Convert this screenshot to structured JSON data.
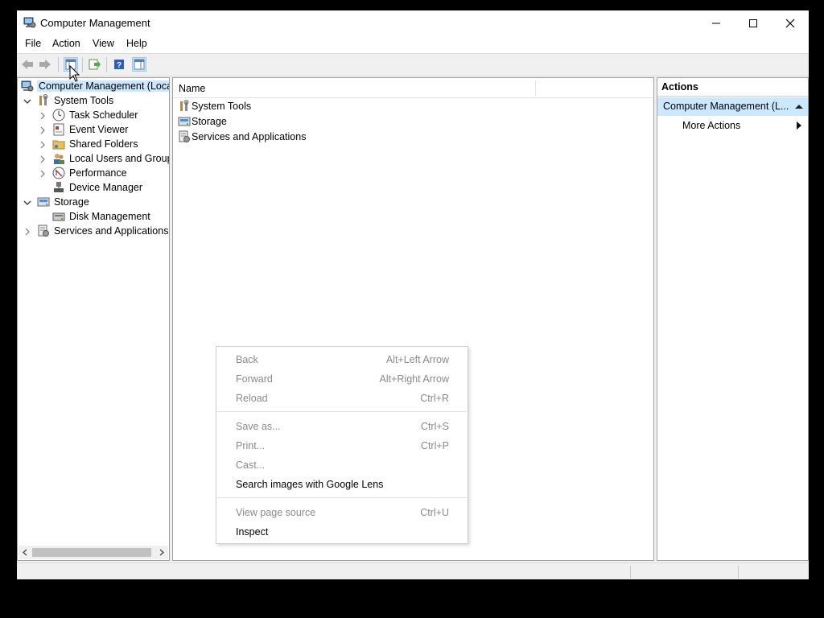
{
  "window": {
    "title": "Computer Management",
    "controls": [
      "minimize",
      "maximize",
      "close"
    ]
  },
  "menubar": [
    "File",
    "Action",
    "View",
    "Help"
  ],
  "toolbar": {
    "buttons": [
      "back-icon",
      "forward-icon",
      "show-hide-console-tree-icon",
      "export-list-icon",
      "help-icon",
      "show-hide-action-pane-icon"
    ]
  },
  "tree": {
    "root": "Computer Management (Local",
    "system_tools": "System Tools",
    "task_scheduler": "Task Scheduler",
    "event_viewer": "Event Viewer",
    "shared_folders": "Shared Folders",
    "local_users": "Local Users and Groups",
    "performance": "Performance",
    "device_manager": "Device Manager",
    "storage": "Storage",
    "disk_management": "Disk Management",
    "services_apps": "Services and Applications"
  },
  "center": {
    "column_name": "Name",
    "items": [
      "System Tools",
      "Storage",
      "Services and Applications"
    ]
  },
  "actions": {
    "header": "Actions",
    "section": "Computer Management (L...",
    "more": "More Actions"
  },
  "context_menu": {
    "back": {
      "label": "Back",
      "shortcut": "Alt+Left Arrow"
    },
    "forward": {
      "label": "Forward",
      "shortcut": "Alt+Right Arrow"
    },
    "reload": {
      "label": "Reload",
      "shortcut": "Ctrl+R"
    },
    "save_as": {
      "label": "Save as...",
      "shortcut": "Ctrl+S"
    },
    "print": {
      "label": "Print...",
      "shortcut": "Ctrl+P"
    },
    "cast": {
      "label": "Cast..."
    },
    "lens": {
      "label": "Search images with Google Lens"
    },
    "view_source": {
      "label": "View page source",
      "shortcut": "Ctrl+U"
    },
    "inspect": {
      "label": "Inspect"
    }
  },
  "colors": {
    "selection": "#cce8ff",
    "disabled_text": "#8a8a8a",
    "toolbar_pressed": "#cce4f7"
  }
}
